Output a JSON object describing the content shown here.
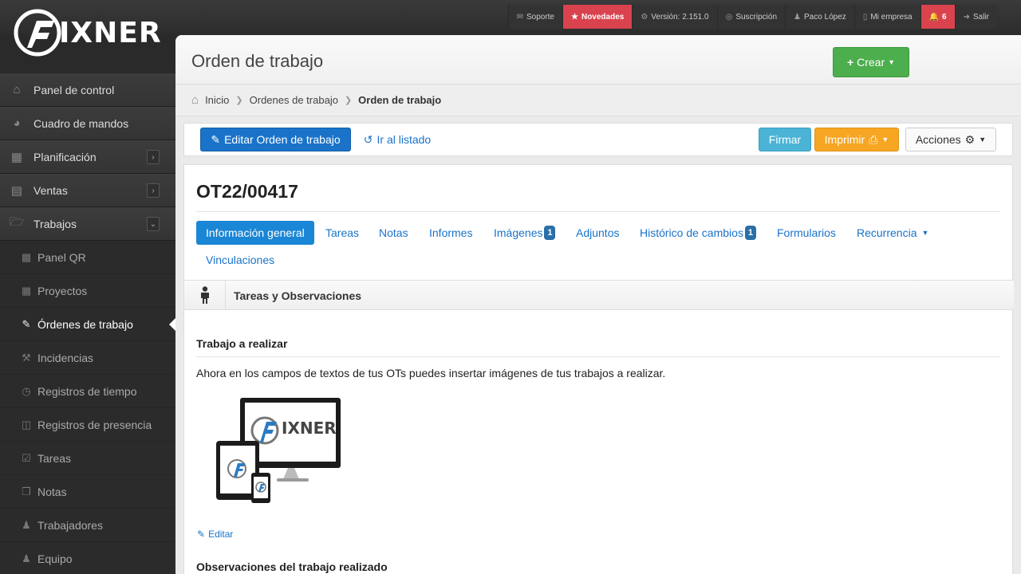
{
  "brand": {
    "name": "IXNER"
  },
  "topnav": [
    {
      "label": "Soporte",
      "icon": "megaphone-icon"
    },
    {
      "label": "Novedades",
      "icon": "star-icon"
    },
    {
      "label": "Versión: 2.151.0",
      "icon": "gear-icon"
    },
    {
      "label": "Suscripción",
      "icon": "circle-icon"
    },
    {
      "label": "Paco López",
      "icon": "user-icon"
    },
    {
      "label": "Mi empresa",
      "icon": "building-icon"
    },
    {
      "label": "6",
      "icon": "bell-icon"
    },
    {
      "label": "Salir",
      "icon": "logout-icon"
    }
  ],
  "sidebar": {
    "items": [
      {
        "label": "Panel de control"
      },
      {
        "label": "Cuadro de mandos"
      },
      {
        "label": "Planificación"
      },
      {
        "label": "Ventas"
      },
      {
        "label": "Trabajos"
      }
    ],
    "subitems": [
      {
        "label": "Panel QR"
      },
      {
        "label": "Proyectos"
      },
      {
        "label": "Órdenes de trabajo"
      },
      {
        "label": "Incidencias"
      },
      {
        "label": "Registros de tiempo"
      },
      {
        "label": "Registros de presencia"
      },
      {
        "label": "Tareas"
      },
      {
        "label": "Notas"
      },
      {
        "label": "Trabajadores"
      },
      {
        "label": "Equipo"
      }
    ]
  },
  "header": {
    "title": "Orden de trabajo",
    "create_label": "Crear"
  },
  "breadcrumb": {
    "home": "Inicio",
    "parent": "Ordenes de trabajo",
    "current": "Orden de trabajo"
  },
  "toolbar": {
    "edit_label": "Editar Orden de trabajo",
    "list_label": "Ir al listado",
    "sign_label": "Firmar",
    "print_label": "Imprimir",
    "actions_label": "Acciones"
  },
  "ot": {
    "code": "OT22/00417",
    "tabs": [
      {
        "label": "Información general"
      },
      {
        "label": "Tareas"
      },
      {
        "label": "Notas"
      },
      {
        "label": "Informes"
      },
      {
        "label": "Imágenes",
        "badge": "1"
      },
      {
        "label": "Adjuntos"
      },
      {
        "label": "Histórico de cambios",
        "badge": "1"
      },
      {
        "label": "Formularios"
      },
      {
        "label": "Recurrencia"
      },
      {
        "label": "Vinculaciones"
      }
    ]
  },
  "section": {
    "title": "Tareas y Observaciones",
    "work_title": "Trabajo a realizar",
    "work_text": "Ahora en los campos de textos de tus OTs puedes insertar imágenes de tus trabajos a realizar.",
    "image_brand": "IXNER",
    "edit_label": "Editar",
    "observations_title": "Observaciones del trabajo realizado"
  }
}
